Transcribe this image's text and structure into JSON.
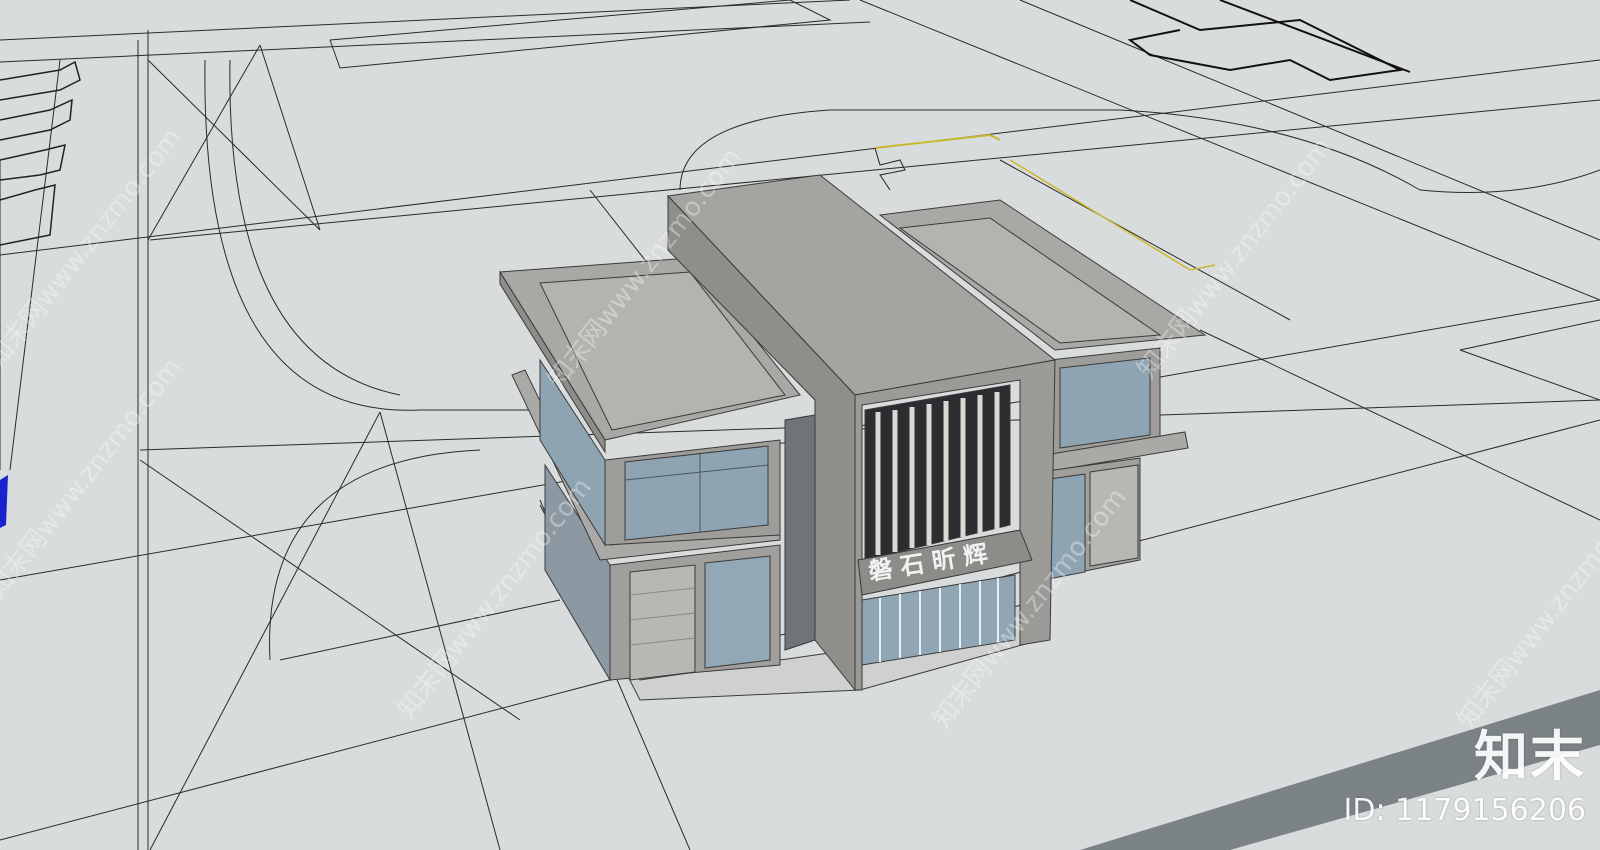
{
  "building": {
    "sign_text": "磐石昕辉"
  },
  "watermark": {
    "logo": "知末",
    "id_text": "ID: 1179156206",
    "diagonal_text": "知末网www.znzmo.com"
  },
  "colors": {
    "ground": "#d9dcdc",
    "line": "#2a2a2a",
    "roof": "#a9a8a5",
    "wall": "#9d9c99",
    "glass": "#8fa4b3",
    "stone": "#b9b7b2",
    "road": "#7c8386",
    "marker": "#1a22d0"
  }
}
